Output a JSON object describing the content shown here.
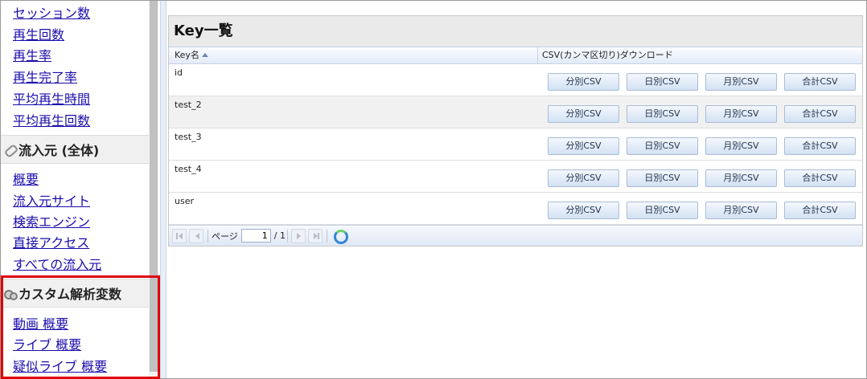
{
  "sidebar": {
    "links_top": [
      "セッション数",
      "再生回数",
      "再生率",
      "再生完了率",
      "平均再生時間",
      "平均再生回数"
    ],
    "section_inflow": {
      "icon": "link-icon",
      "title": "流入元 (全体)",
      "links": [
        "概要",
        "流入元サイト",
        "検索エンジン",
        "直接アクセス",
        "すべての流入元"
      ]
    },
    "section_custom": {
      "icon": "gear-icon",
      "title": "カスタム解析変数",
      "links": [
        "動画 概要",
        "ライブ 概要",
        "疑似ライブ 概要"
      ]
    }
  },
  "grid": {
    "title": "Key一覧",
    "columns": {
      "key": "Key名",
      "csv": "CSV(カンマ区切り)ダウンロード"
    },
    "buttons": {
      "minute": "分別CSV",
      "day": "日別CSV",
      "month": "月別CSV",
      "total": "合計CSV"
    },
    "rows": [
      {
        "key": "id"
      },
      {
        "key": "test_2"
      },
      {
        "key": "test_3"
      },
      {
        "key": "test_4"
      },
      {
        "key": "user"
      }
    ],
    "pager": {
      "page_label": "ページ",
      "current_page": "1",
      "total_label": "/ 1"
    }
  },
  "colors": {
    "highlight": "#e00000",
    "link": "#1a0dab",
    "header_bg": "#eaeaea"
  }
}
